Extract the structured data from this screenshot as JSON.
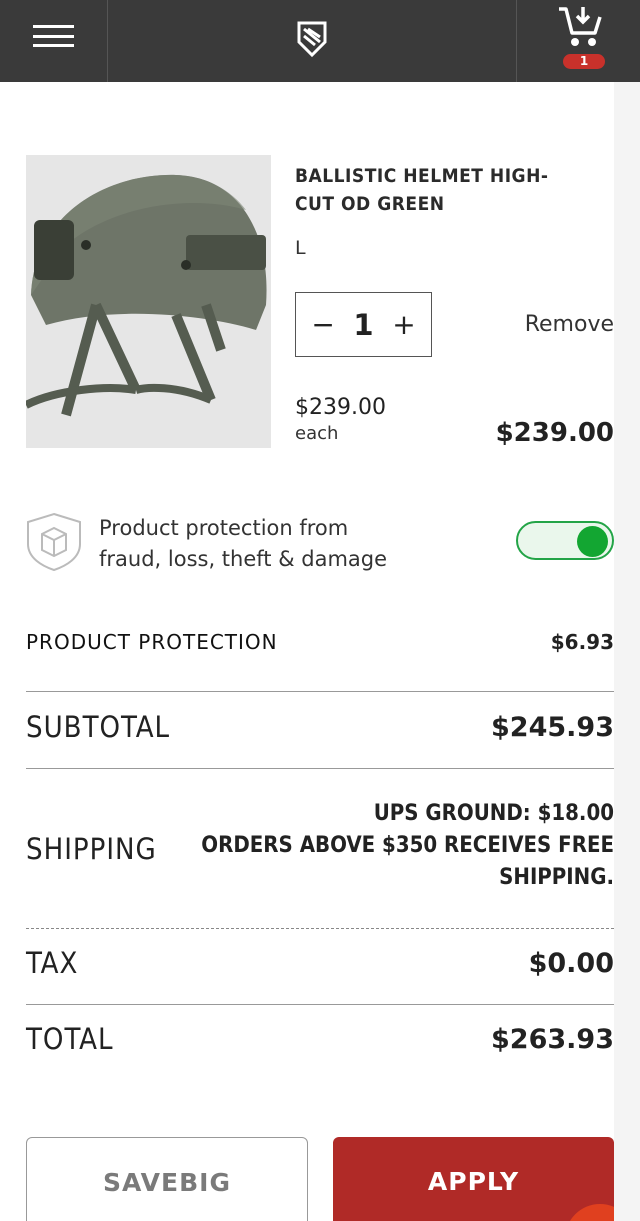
{
  "header": {
    "menu_icon": "hamburger-icon",
    "logo_icon": "brand-shield-logo",
    "cart_icon": "cart-icon",
    "cart_count": "1"
  },
  "item": {
    "title_line1": "BALLISTIC HELMET HIGH-",
    "title_line2": "CUT OD GREEN",
    "size": "L",
    "quantity": "1",
    "minus": "−",
    "plus": "+",
    "remove_label": "Remove",
    "unit_price": "$239.00",
    "unit_label": "each",
    "line_total": "$239.00"
  },
  "protection": {
    "text_line1": "Product protection from",
    "text_line2": "fraud, loss, theft & damage",
    "toggle_on": true,
    "toggle_color": "#13a632"
  },
  "summary": {
    "protection_label": "PRODUCT PROTECTION",
    "protection_value": "$6.93",
    "subtotal_label": "SUBTOTAL",
    "subtotal_value": "$245.93",
    "shipping_label": "SHIPPING",
    "shipping_line1": "UPS GROUND: $18.00",
    "shipping_line2": "ORDERS ABOVE $350 RECEIVES FREE",
    "shipping_line3": "SHIPPING.",
    "tax_label": "TAX",
    "tax_value": "$0.00",
    "total_label": "TOTAL",
    "total_value": "$263.93"
  },
  "promo": {
    "code_value": "SAVEBIG",
    "apply_label": "APPLY",
    "apply_color": "#b02a27"
  }
}
